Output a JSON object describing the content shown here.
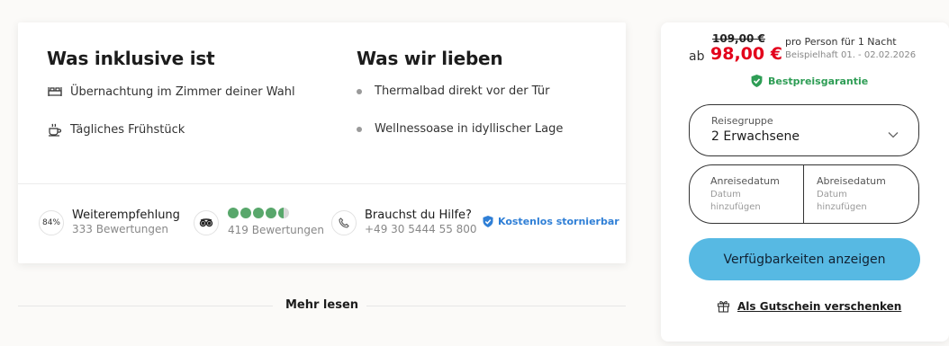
{
  "inclusive": {
    "title": "Was inklusive ist",
    "items": [
      {
        "icon": "bed-icon",
        "label": "Übernachtung im Zimmer deiner Wahl"
      },
      {
        "icon": "coffee-cup-icon",
        "label": "Tägliches Frühstück"
      }
    ]
  },
  "love": {
    "title": "Was wir lieben",
    "items": [
      {
        "label": "Thermalbad direkt vor der Tür"
      },
      {
        "label": "Wellnessoase in idyllischer Lage"
      }
    ]
  },
  "recommendation": {
    "percent": "84%",
    "title": "Weiterempfehlung",
    "count": "333 Bewertungen"
  },
  "tripadvisor": {
    "rating": 4.5,
    "count": "419 Bewertungen"
  },
  "help": {
    "title": "Brauchst du Hilfe?",
    "phone": "+49 30 5444 55 800"
  },
  "cancellation": "Kostenlos stornierbar",
  "more_label": "Mehr lesen",
  "booking": {
    "old_price": "109,00 €",
    "prefix": "ab",
    "price": "98,00 €",
    "per_person": "pro Person für 1 Nacht",
    "example": "Beispielhaft 01. - 02.02.2026",
    "guarantee": "Bestpreisgarantie",
    "travel_group_label": "Reisegruppe",
    "travel_group_value": "2 Erwachsene",
    "arrival_label": "Anreisedatum",
    "arrival_placeholder": "Datum hinzufügen",
    "departure_label": "Abreisedatum",
    "departure_placeholder": "Datum hinzufügen",
    "cta": "Verfügbarkeiten anzeigen",
    "gift": "Als Gutschein verschenken"
  },
  "colors": {
    "accent": "#57b9e3",
    "price_red": "#e3001b",
    "green": "#2e9d55",
    "blue": "#2f7fd6"
  }
}
